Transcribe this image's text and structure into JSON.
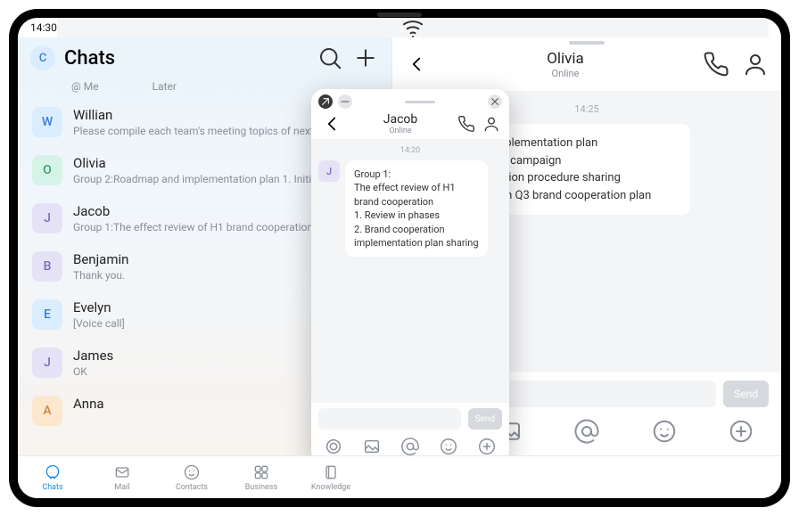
{
  "statusbar": {
    "time": "14:30"
  },
  "left": {
    "header": {
      "avatar_letter": "C",
      "title": "Chats"
    },
    "subtabs": {
      "at_me": "@ Me",
      "later": "Later"
    },
    "items": [
      {
        "letter": "W",
        "color": "c-blue",
        "name": "Willian",
        "preview": "Please compile each team's meeting topics of next month"
      },
      {
        "letter": "O",
        "color": "c-green",
        "name": "Olivia",
        "preview": "Group 2:Roadmap and implementation plan  1. Initiation"
      },
      {
        "letter": "J",
        "color": "c-lav",
        "name": "Jacob",
        "preview": "Group 1:The effect review of H1 brand cooperation"
      },
      {
        "letter": "B",
        "color": "c-lav",
        "name": "Benjamin",
        "preview": "Thank you."
      },
      {
        "letter": "E",
        "color": "c-blue",
        "name": "Evelyn",
        "preview": "[Voice call]"
      },
      {
        "letter": "J",
        "color": "c-lav",
        "name": "James",
        "preview": "OK"
      },
      {
        "letter": "A",
        "color": "c-orange",
        "name": "Anna",
        "preview": ""
      }
    ]
  },
  "right": {
    "contact_name": "Olivia",
    "contact_status": "Online",
    "timestamp": "14:25",
    "message": "Roadmap and implementation plan\n1. Initiate the BTL campaign\n2. Brand cooperation procedure sharing\n3. Effect review on Q3 brand cooperation plan",
    "send_label": "Send"
  },
  "float": {
    "contact_name": "Jacob",
    "contact_status": "Online",
    "timestamp": "14:20",
    "sender_letter": "J",
    "message": "Group 1:\nThe effect review of H1 brand cooperation\n1. Review in phases\n2. Brand cooperation implementation plan sharing",
    "send_label": "Send"
  },
  "nav": {
    "chats": "Chats",
    "mail": "Mail",
    "contacts": "Contacts",
    "business": "Business",
    "knowledge": "Knowledge"
  }
}
